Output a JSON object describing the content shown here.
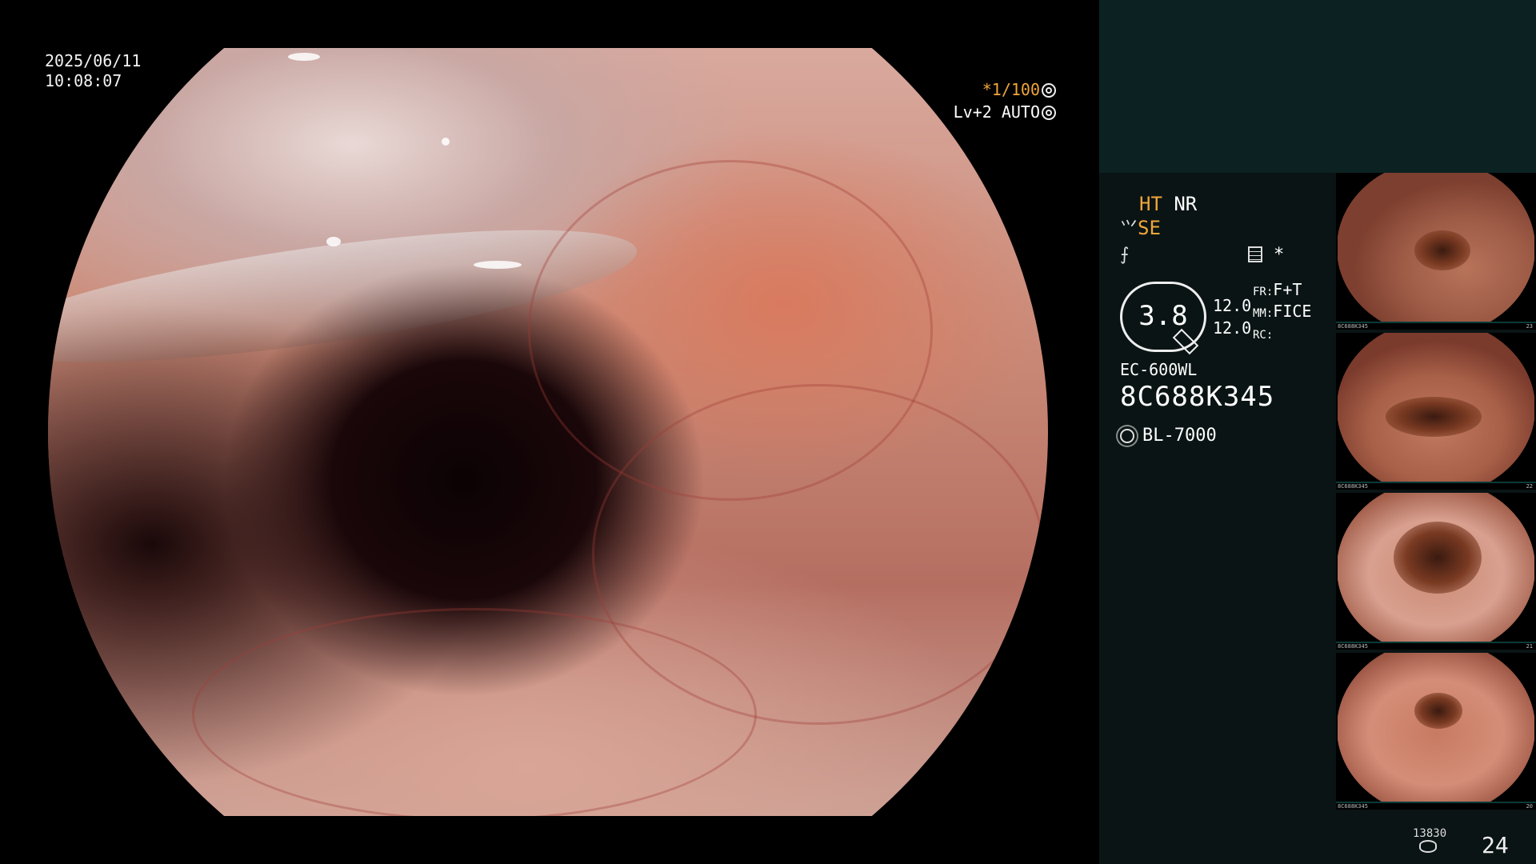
{
  "viewer": {
    "date": "2025/06/11",
    "time": "10:08:07",
    "shutter": "*1/100",
    "level": "Lv+2 AUTO"
  },
  "panel": {
    "ht": "HT",
    "nr": "NR",
    "se": "SE",
    "gauge_value": "3.8",
    "val1": "12.0",
    "val2": "12.0",
    "fr_key": "FR:",
    "fr_val": "F+T",
    "mm_key": "MM:",
    "mm_val": "FICE",
    "rc_key": "RC:",
    "star": "*",
    "model": "EC-600WL",
    "serial": "8C688K345",
    "lamp": "BL-7000",
    "counter_small": "13830",
    "counter_big": "24"
  },
  "thumbnails": [
    {
      "tag": "8C688K345",
      "num": "23"
    },
    {
      "tag": "8C688K345",
      "num": "22"
    },
    {
      "tag": "8C688K345",
      "num": "21"
    },
    {
      "tag": "8C688K345",
      "num": "20"
    }
  ],
  "icons": [
    "aperture-icon",
    "auto-icon",
    "scope-icon",
    "wave-icon",
    "doc-icon",
    "lamp-icon",
    "drum-icon"
  ]
}
